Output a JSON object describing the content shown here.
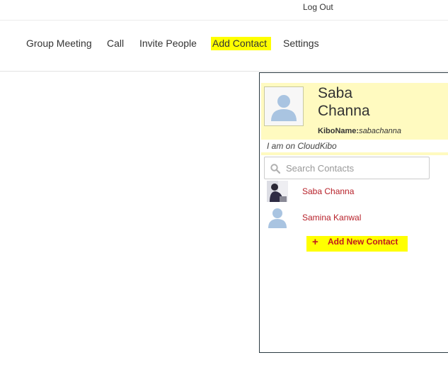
{
  "header": {
    "logout_label": "Log Out"
  },
  "nav": {
    "items": [
      {
        "label": "Group Meeting"
      },
      {
        "label": "Call"
      },
      {
        "label": "Invite People"
      },
      {
        "label": "Add Contact",
        "highlighted": true
      },
      {
        "label": "Settings"
      }
    ]
  },
  "profile": {
    "first_name": "Saba",
    "last_name": "Channa",
    "kiboname_label": "KiboName:",
    "kiboname_value": "sabachanna",
    "status": "I am on CloudKibo",
    "avatar_icon": "user-silhouette-icon"
  },
  "search": {
    "placeholder": "Search Contacts",
    "value": "",
    "icon": "search-icon"
  },
  "contacts": [
    {
      "name": "Saba Channa",
      "avatar": "photo"
    },
    {
      "name": "Samina Kanwal",
      "avatar": "user-silhouette-icon"
    }
  ],
  "add_new_contact": {
    "label": "Add New Contact",
    "icon": "plus-icon"
  },
  "colors": {
    "highlight": "#ffff00",
    "profile_bg": "#fffac0",
    "contact_name": "#b7212a",
    "avatar_blue": "#a9c4e1"
  }
}
